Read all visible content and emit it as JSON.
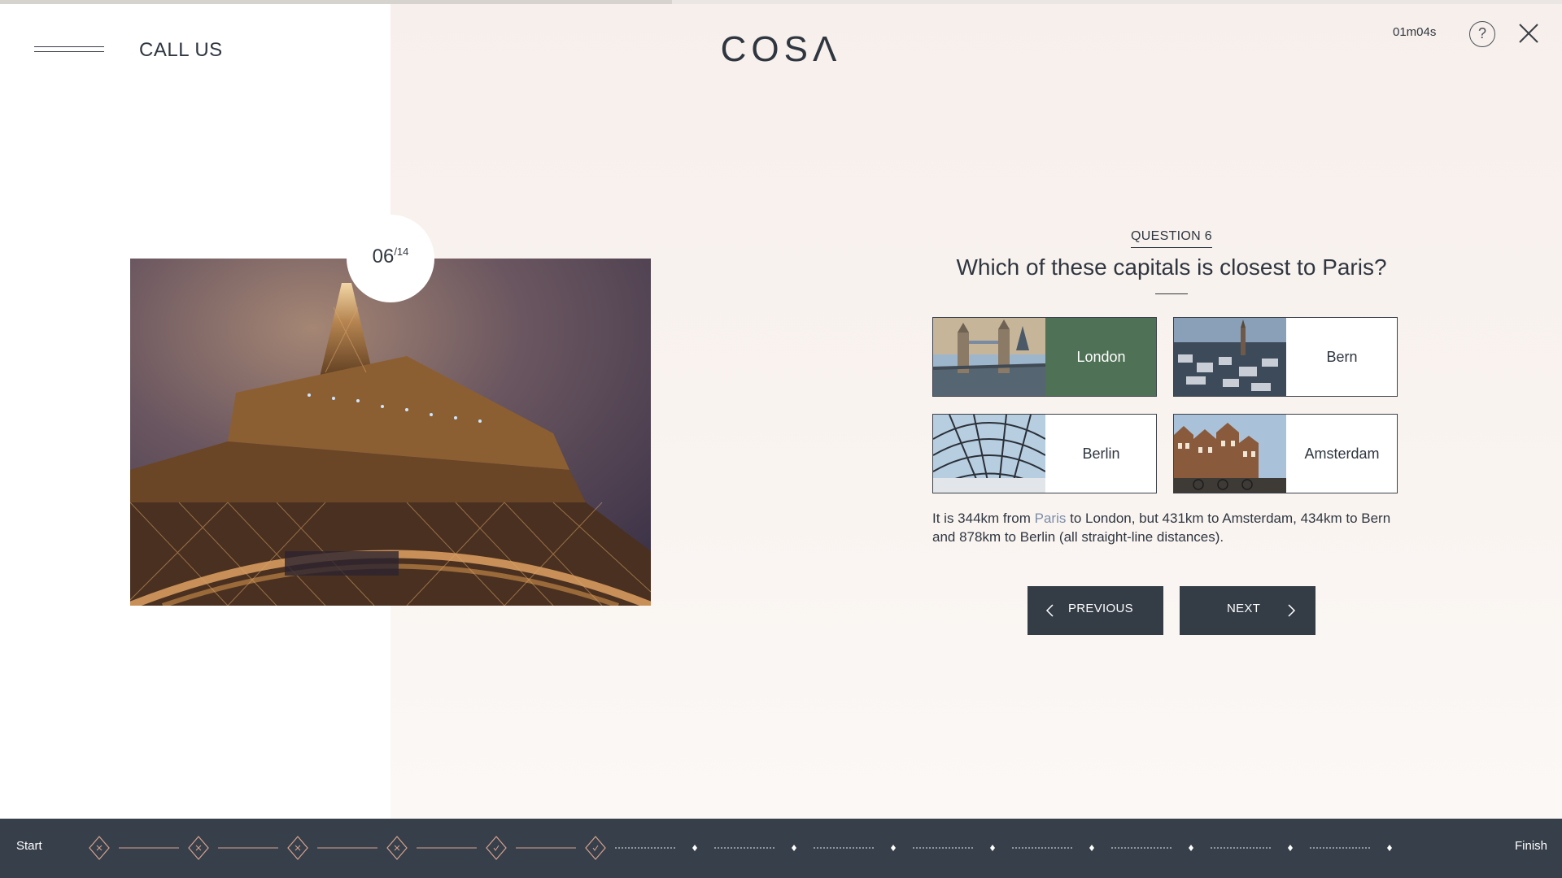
{
  "header": {
    "call_us": "CALL US",
    "logo": "COSΛ",
    "timer": "01m04s",
    "help_glyph": "?",
    "menu_icon": "hamburger-icon",
    "close_icon": "close-icon"
  },
  "progress_top": {
    "fraction": 0.43
  },
  "counter": {
    "current": "06",
    "total": "/14"
  },
  "question": {
    "label": "QUESTION 6",
    "title": "Which of these capitals is closest to Paris?",
    "options": [
      {
        "label": "London",
        "selected": true
      },
      {
        "label": "Bern",
        "selected": false
      },
      {
        "label": "Berlin",
        "selected": false
      },
      {
        "label": "Amsterdam",
        "selected": false
      }
    ],
    "explanation_before": "It is 344km from ",
    "explanation_highlight": "Paris",
    "explanation_after": " to London, but 431km to Amsterdam, 434km to Bern and 878km to Berlin (all straight-line distances)."
  },
  "nav": {
    "previous": "PREVIOUS",
    "next": "NEXT"
  },
  "progress": {
    "start": "Start",
    "finish": "Finish",
    "steps": [
      "x",
      "x",
      "x",
      "x",
      "check",
      "check",
      "todo",
      "todo",
      "todo",
      "todo",
      "todo",
      "todo",
      "todo",
      "todo"
    ]
  },
  "colors": {
    "selected": "#4f7155",
    "dark": "#343c46",
    "accent_diamond": "#d7a38f",
    "link": "#7b8da6"
  }
}
